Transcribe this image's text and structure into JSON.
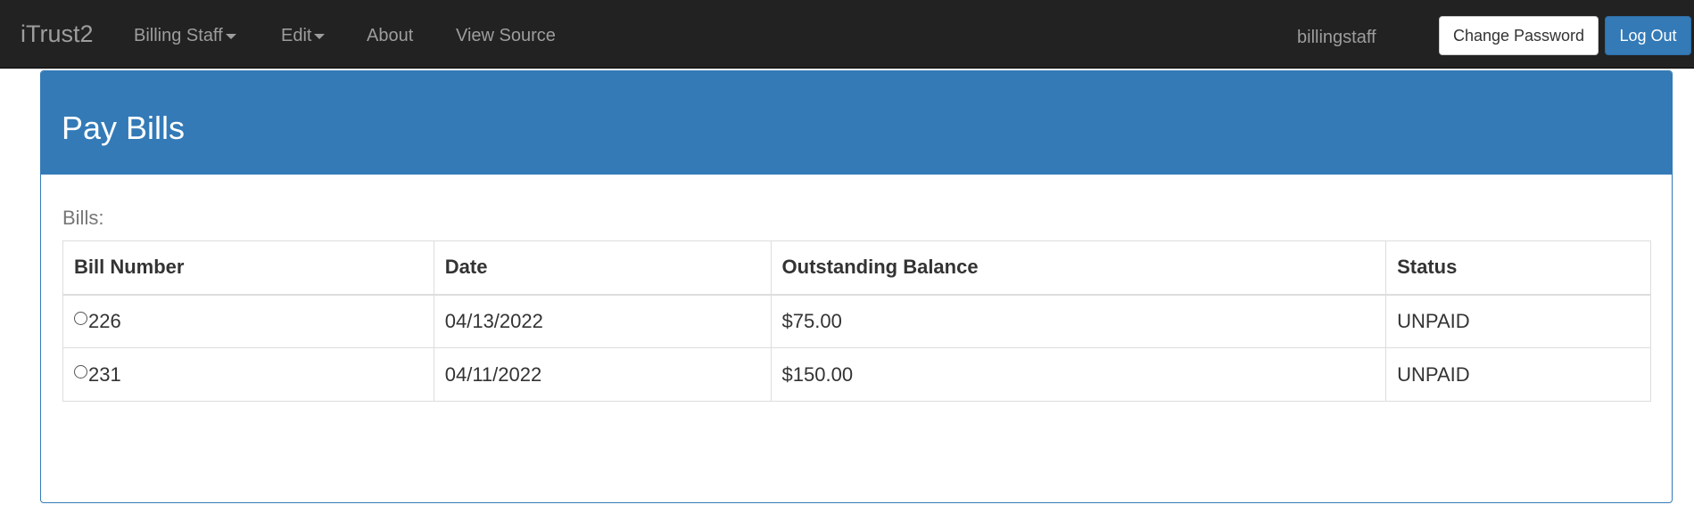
{
  "navbar": {
    "brand": "iTrust2",
    "items": [
      {
        "label": "Billing Staff",
        "dropdown": true
      },
      {
        "label": "Edit",
        "dropdown": true
      },
      {
        "label": "About",
        "dropdown": false
      },
      {
        "label": "View Source",
        "dropdown": false
      }
    ],
    "username": "billingstaff",
    "change_password_label": "Change Password",
    "logout_label": "Log Out"
  },
  "panel": {
    "title": "Pay Bills",
    "bills_label": "Bills:",
    "table": {
      "headers": [
        "Bill Number",
        "Date",
        "Outstanding Balance",
        "Status"
      ],
      "rows": [
        {
          "bill_number": "226",
          "date": "04/13/2022",
          "balance": "$75.00",
          "status": "UNPAID",
          "selected": false
        },
        {
          "bill_number": "231",
          "date": "04/11/2022",
          "balance": "$150.00",
          "status": "UNPAID",
          "selected": false
        }
      ]
    }
  },
  "colors": {
    "navbar_bg": "#222222",
    "navbar_text": "#9d9d9d",
    "primary": "#337ab7"
  }
}
